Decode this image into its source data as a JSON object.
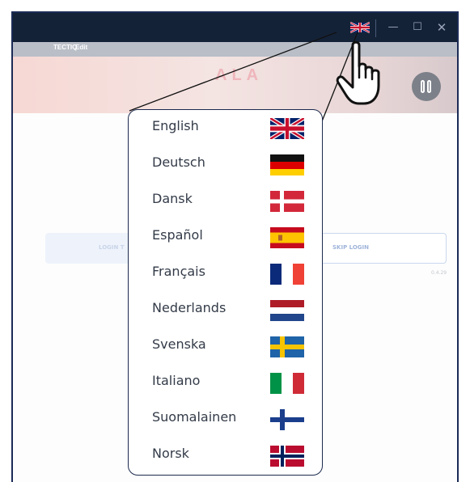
{
  "menubar": {
    "brand": "TECTIQ",
    "edit": "Edit"
  },
  "hero": {
    "partial_text": "ALA"
  },
  "buttons": {
    "login": "LOGIN T",
    "skip": "SKIP LOGIN"
  },
  "version": "0.4.29",
  "window_controls": {
    "minimize": "—",
    "maximize": "☐",
    "close": "✕"
  },
  "languages": [
    {
      "label": "English",
      "flag": "uk-flag"
    },
    {
      "label": "Deutsch",
      "flag": "germany-flag"
    },
    {
      "label": "Dansk",
      "flag": "denmark-flag"
    },
    {
      "label": "Español",
      "flag": "spain-flag"
    },
    {
      "label": "Français",
      "flag": "france-flag"
    },
    {
      "label": "Nederlands",
      "flag": "netherlands-flag"
    },
    {
      "label": "Svenska",
      "flag": "sweden-flag"
    },
    {
      "label": "Italiano",
      "flag": "italy-flag"
    },
    {
      "label": "Suomalainen",
      "flag": "finland-flag"
    },
    {
      "label": "Norsk",
      "flag": "norway-flag"
    }
  ],
  "colors": {
    "titlebar": "#142238",
    "menu_border": "#1c2a4e",
    "text": "#333b48",
    "pause_button": "#7c8089"
  }
}
